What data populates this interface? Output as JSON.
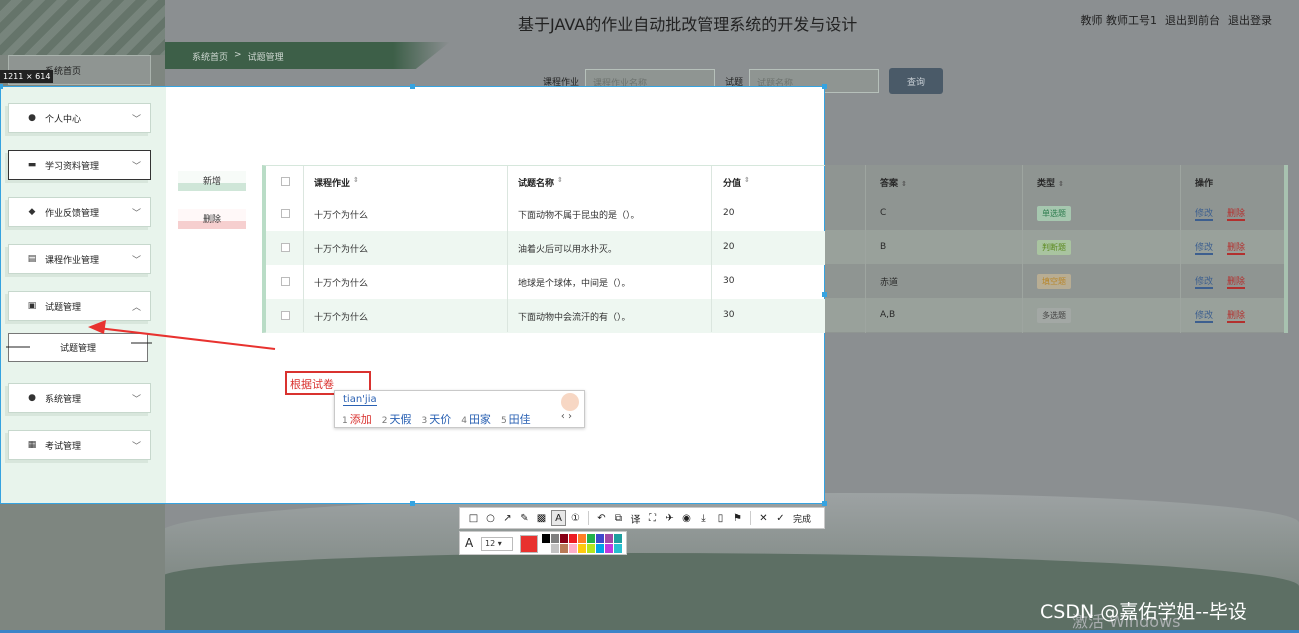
{
  "header": {
    "title": "基于JAVA的作业自动批改管理系统的开发与设计",
    "user_role": "教师",
    "user_name": "教师工号1",
    "exit_front": "退出到前台",
    "logout": "退出登录"
  },
  "breadcrumb": {
    "home": "系统首页",
    "sep": ">",
    "current": "试题管理"
  },
  "search": {
    "course_label": "课程作业",
    "course_placeholder": "课程作业名称",
    "question_label": "试题",
    "question_placeholder": "试题名称",
    "button": "查询"
  },
  "sidebar": {
    "home": "系统首页",
    "items": [
      {
        "label": "个人中心",
        "icon": "user-icon"
      },
      {
        "label": "学习资料管理",
        "icon": "briefcase-icon"
      },
      {
        "label": "作业反馈管理",
        "icon": "feedback-icon"
      },
      {
        "label": "课程作业管理",
        "icon": "clipboard-icon"
      },
      {
        "label": "试题管理",
        "icon": "checklist-icon"
      },
      {
        "label": "系统管理",
        "icon": "user-icon"
      },
      {
        "label": "考试管理",
        "icon": "grid-icon"
      }
    ],
    "sub_item": "试题管理"
  },
  "actions": {
    "add": "新增",
    "delete": "删除"
  },
  "table": {
    "headers": [
      "课程作业",
      "试题名称",
      "分值",
      "答案",
      "类型",
      "操作"
    ],
    "edit": "修改",
    "del": "删除",
    "rows": [
      {
        "course": "十万个为什么",
        "question": "下面动物不属于昆虫的是（）。",
        "score": "20",
        "answer": "C",
        "type": "单选题",
        "type_color": "#2e7d4f"
      },
      {
        "course": "十万个为什么",
        "question": "油着火后可以用水扑灭。",
        "score": "20",
        "answer": "B",
        "type": "判断题",
        "type_color": "#5c8a1f"
      },
      {
        "course": "十万个为什么",
        "question": "地球是个球体，中间是（）。",
        "score": "30",
        "answer": "赤道",
        "type": "填空题",
        "type_color": "#b8862a"
      },
      {
        "course": "十万个为什么",
        "question": "下面动物中会流汗的有（）。",
        "score": "30",
        "answer": "A,B",
        "type": "多选题",
        "type_color": "#555555"
      }
    ]
  },
  "screenshot_tool": {
    "size_label": "1211 × 614",
    "typed_text": "根据试卷",
    "ime_composition": "tian'jia",
    "ime_candidates": [
      {
        "num": "1",
        "text": "添加"
      },
      {
        "num": "2",
        "text": "天假"
      },
      {
        "num": "3",
        "text": "天价"
      },
      {
        "num": "4",
        "text": "田家"
      },
      {
        "num": "5",
        "text": "田佳"
      }
    ],
    "done": "完成",
    "font_size": "12",
    "current_color": "#e8322f",
    "palette": [
      "#000000",
      "#7f7f7f",
      "#880015",
      "#ed1c24",
      "#ff7f27",
      "#22b14c",
      "#3f48cc",
      "#a349a4",
      "#1f9f9f",
      "#ffffff",
      "#c3c3c3",
      "#b97a57",
      "#ffaec9",
      "#ffc90e",
      "#b5e61d",
      "#00a2e8",
      "#c039e0",
      "#29c0d0"
    ]
  },
  "watermark": "CSDN @嘉佑学姐--毕设",
  "windows_activation": "激活 Windows"
}
